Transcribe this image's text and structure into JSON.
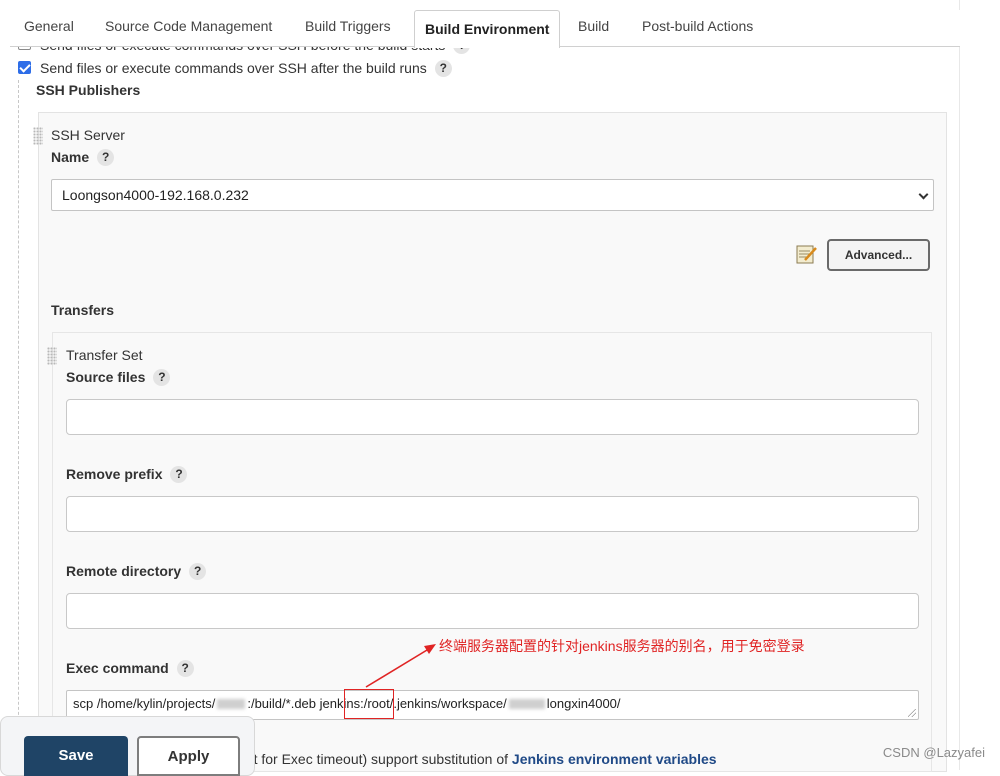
{
  "tabs": [
    {
      "label": "General",
      "active": false
    },
    {
      "label": "Source Code Management",
      "active": false
    },
    {
      "label": "Build Triggers",
      "active": false
    },
    {
      "label": "Build Environment",
      "active": true
    },
    {
      "label": "Build",
      "active": false
    },
    {
      "label": "Post-build Actions",
      "active": false
    }
  ],
  "options": {
    "before_build_label": "Send files or execute commands over SSH before the build starts",
    "before_build_checked": false,
    "after_build_label": "Send files or execute commands over SSH after the build runs",
    "after_build_checked": true
  },
  "help_glyph": "?",
  "ssh_publishers": {
    "title": "SSH Publishers",
    "server_header": "SSH Server",
    "name_label": "Name",
    "name_value": "Loongson4000-192.168.0.232",
    "advanced_label": "Advanced..."
  },
  "transfers": {
    "title": "Transfers",
    "set_header": "Transfer Set",
    "source_files_label": "Source files",
    "source_files_value": "",
    "remove_prefix_label": "Remove prefix",
    "remove_prefix_value": "",
    "remote_directory_label": "Remote directory",
    "remote_directory_value": "",
    "exec_command_label": "Exec command",
    "exec_command_part1": "scp /home/kylin/projects/",
    "exec_command_part2": ":/build/*.deb ",
    "exec_command_highlight": "jenkins",
    "exec_command_part3": ":/root/.jenkins/workspace/",
    "exec_command_part4": "longxin4000/"
  },
  "annotation": {
    "text": "终端服务器配置的针对jenkins服务器的别名，用于免密登录",
    "color": "#e02424"
  },
  "footer": {
    "save_label": "Save",
    "apply_label": "Apply",
    "note_prefix": "ept for Exec timeout) support substitution of ",
    "note_link": "Jenkins environment variables"
  },
  "watermark": "CSDN @Lazyafei",
  "colors": {
    "save_button_bg": "#1f4466",
    "link": "#204a87",
    "checkbox_checked": "#2d6de8"
  }
}
